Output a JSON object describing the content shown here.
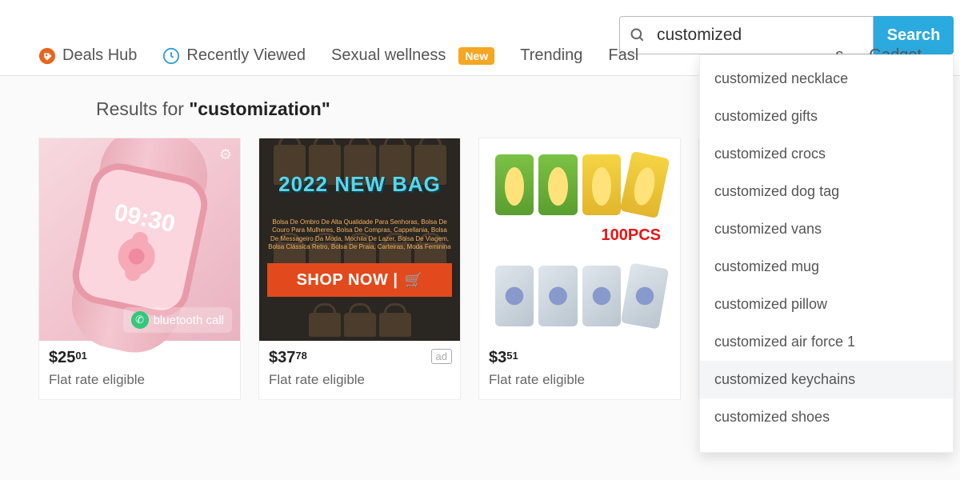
{
  "search": {
    "value": "customized",
    "button": "Search"
  },
  "nav": {
    "deals": "Deals Hub",
    "recent": "Recently Viewed",
    "wellness": "Sexual wellness",
    "new_badge": "New",
    "trending": "Trending",
    "fashion": "Fasl",
    "frag_s": "s",
    "gadget": "Gadget"
  },
  "results": {
    "prefix": "Results for ",
    "query": "\"customization\""
  },
  "products": [
    {
      "price_whole": "$25",
      "price_cents": "01",
      "ship": "Flat rate eligible",
      "watch_time": "09:30",
      "bt_label": "bluetooth call"
    },
    {
      "price_whole": "$37",
      "price_cents": "78",
      "ship": "Flat rate eligible",
      "banner": "2022 NEW BAG",
      "sub": "Bolsa De Ombro De Alta Qualidade Para Senhoras, Bolsa De Couro Para Mulheres, Bolsa De Compras, Cappellania, Bolsa De Messageiro Da Moda, Mochila De Lazer, Bolsa De Viagem, Bolsa Clássica Retro, Bolsa De Praia, Carteiras, Moda Feminina",
      "cta": "SHOP NOW |",
      "ad": "ad"
    },
    {
      "price_whole": "$3",
      "price_cents": "51",
      "ship": "Flat rate eligible",
      "hundred": "100PCS"
    }
  ],
  "suggestions": [
    "customized necklace",
    "customized gifts",
    "customized crocs",
    "customized dog tag",
    "customized vans",
    "customized mug",
    "customized pillow",
    "customized air force 1",
    "customized keychains",
    "customized shoes"
  ]
}
